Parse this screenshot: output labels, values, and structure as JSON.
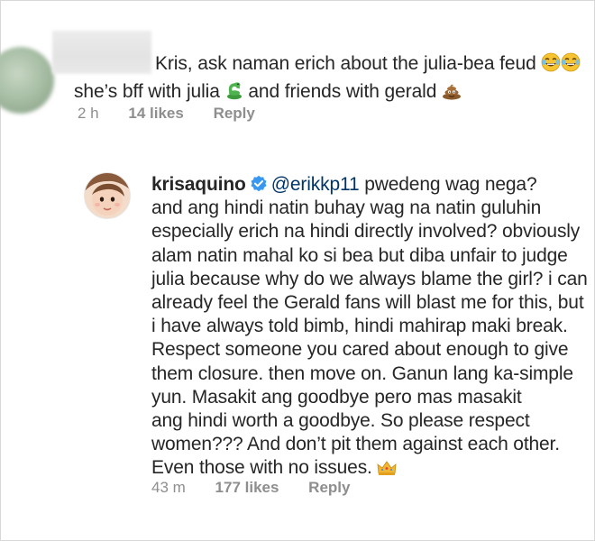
{
  "comment": {
    "text_line1": "Kris, ask naman erich about the julia-bea feud",
    "text_line2_a": "she’s bff with julia",
    "text_line2_b": "and friends with gerald",
    "meta": {
      "time": "2 h",
      "likes": "14 likes",
      "reply": "Reply"
    },
    "emojis": [
      "laughing-tears-emoji",
      "laughing-tears-emoji",
      "snake-emoji",
      "poop-emoji"
    ]
  },
  "reply": {
    "username": "krisaquino",
    "verified": true,
    "mention": "@erikkp11",
    "text_line1": "pwedeng wag nega?",
    "body_lines": [
      "and ang hindi natin buhay wag na natin guluhin",
      "especially erich na hindi directly involved? obviously",
      "alam natin mahal ko si bea but diba unfair to judge",
      "julia because why do we always blame the girl? i can",
      "already feel the Gerald fans will blast me for this, but",
      "i have always told bimb, hindi mahirap maki break.",
      "Respect someone you cared about enough to give",
      "them closure. then move on. Ganun lang ka-simple",
      "yun. Masakit ang goodbye pero mas masakit",
      "ang hindi worth a goodbye. So please respect",
      "women??? And don’t pit them against each other."
    ],
    "last_line": "Even those with no issues.",
    "meta": {
      "time": "43 m",
      "likes": "177 likes",
      "reply": "Reply"
    },
    "emojis": [
      "crown-emoji"
    ]
  },
  "colors": {
    "text": "#262626",
    "meta": "#8e8e8e",
    "mention": "#003569",
    "verified": "#3897f0"
  }
}
